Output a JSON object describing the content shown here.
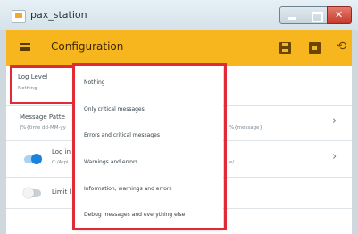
{
  "window": {
    "title": "pax_station"
  },
  "toolbar": {
    "title": "Configuration"
  },
  "settings": {
    "log_level": {
      "label": "Log Level",
      "value": "Nothing"
    },
    "message_pattern": {
      "label": "Message Patte",
      "value_left": "[%{time dd-MM-yy",
      "value_right": "%{message}"
    },
    "log_to_file": {
      "label": "Log in",
      "value_left": "C:/Arpi",
      "value_right": "e/"
    },
    "limit": {
      "label": "Limit l"
    }
  },
  "log_level_menu": {
    "items": [
      "Nothing",
      "Only critical messages",
      "Errors and critical messages",
      "Warnings and errors",
      "Information, warnings and errors",
      "Debug messages and everything else"
    ]
  },
  "colors": {
    "toolbar": "#f8b61e",
    "highlight": "#e02a35",
    "toggle_on": "#1d82dc"
  }
}
